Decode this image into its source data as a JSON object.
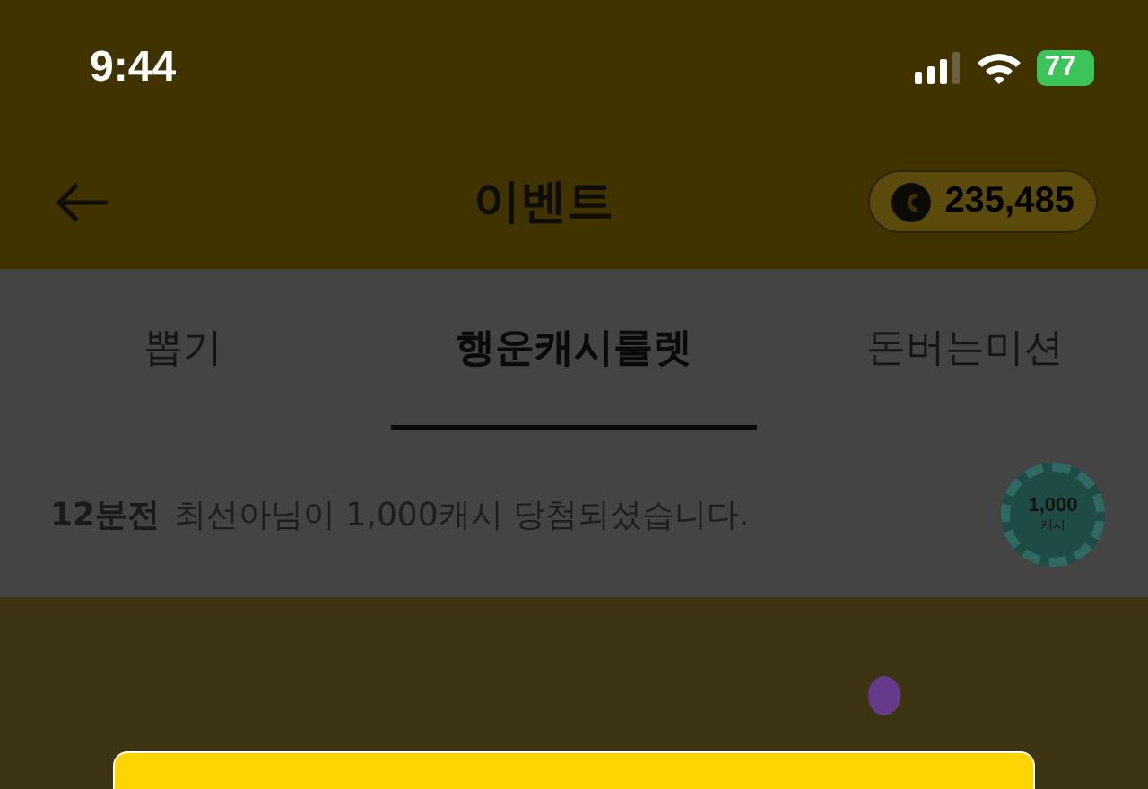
{
  "status_bar": {
    "time": "9:44",
    "battery": "77"
  },
  "header": {
    "title": "이벤트",
    "balance": "235,485"
  },
  "tabs": [
    {
      "label": "뽑기",
      "selected": false
    },
    {
      "label": "행운캐시룰렛",
      "selected": true
    },
    {
      "label": "돈버는미션",
      "selected": false
    }
  ],
  "ticker": {
    "time": "12분전",
    "message": "최선아님이 1,000캐시 당첨되셨습니다.",
    "chip_amount": "1,000",
    "chip_unit": "캐시"
  }
}
